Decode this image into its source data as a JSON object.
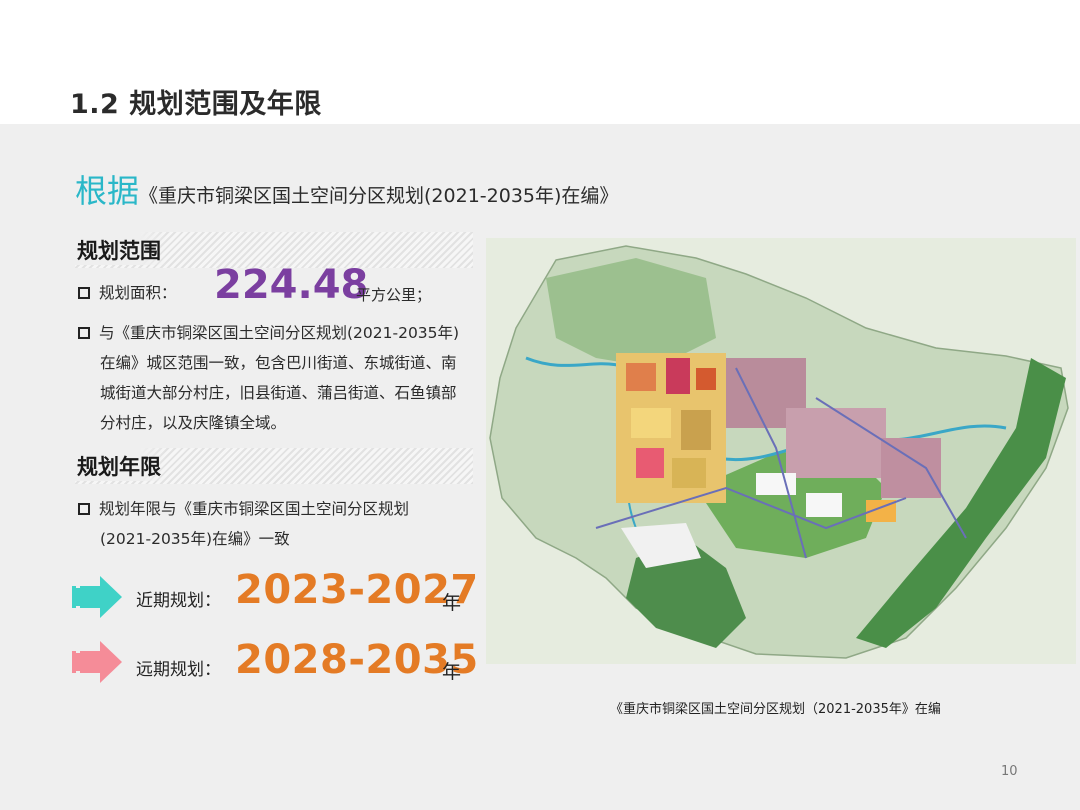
{
  "page": {
    "title": "1.2 规划范围及年限",
    "page_number": "10"
  },
  "basis": {
    "lead": "根据",
    "document": "《重庆市铜梁区国土空间分区规划(2021-2035年)在编》"
  },
  "scope": {
    "heading": "规划范围",
    "area_label": "规划面积：",
    "area_value": "224.48",
    "area_unit": "平方公里；",
    "desc_lines": [
      "与《重庆市铜梁区国土空间分区规划(2021-2035年)",
      "在编》城区范围一致，包含巴川街道、东城街道、南",
      "城街道大部分村庄，旧县街道、蒲吕街道、石鱼镇部",
      "分村庄，以及庆隆镇全域。"
    ]
  },
  "term": {
    "heading": "规划年限",
    "desc_lines": [
      "规划年限与《重庆市铜梁区国土空间分区规划",
      "(2021-2035年)在编》一致"
    ],
    "near": {
      "label": "近期规划：",
      "years": "2023-2027",
      "unit": "年",
      "arrow_color": "#3fd2c7"
    },
    "long": {
      "label": "远期规划：",
      "years": "2028-2035",
      "unit": "年",
      "arrow_color": "#f58c98"
    }
  },
  "map": {
    "caption": "《重庆市铜梁区国土空间分区规划（2021-2035年》在编"
  },
  "colors": {
    "accent_teal": "#2ab7c8",
    "area_purple": "#7b3fa0",
    "years_orange": "#e47b25"
  }
}
